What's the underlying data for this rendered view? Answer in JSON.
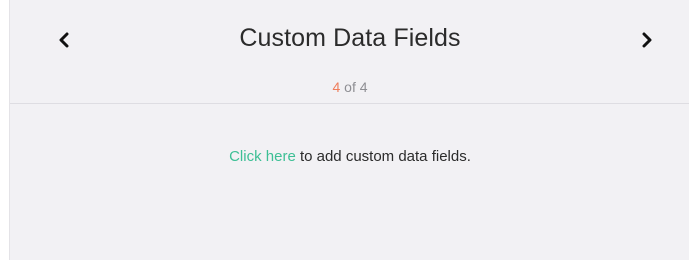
{
  "header": {
    "title": "Custom Data Fields",
    "prev_icon": "chevron-left-icon",
    "next_icon": "chevron-right-icon"
  },
  "pager": {
    "current": "4",
    "separator": " of ",
    "total": "4",
    "current_color": "#ef7d5b"
  },
  "message": {
    "link_text": "Click here",
    "rest_text": " to add custom data fields.",
    "link_color": "#3dbf95"
  }
}
